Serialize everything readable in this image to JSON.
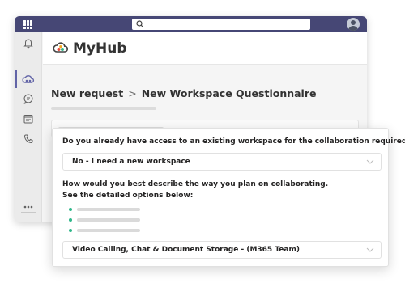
{
  "app": {
    "name": "MyHub"
  },
  "breadcrumb": {
    "parent": "New request",
    "separator": ">",
    "current": "New Workspace Questionnaire"
  },
  "rail": {
    "items": [
      {
        "icon": "bell-icon",
        "active": false
      },
      {
        "icon": "cloud-hub-icon",
        "active": true
      },
      {
        "icon": "chat-icon",
        "active": false
      },
      {
        "icon": "calendar-icon",
        "active": false
      },
      {
        "icon": "phone-icon",
        "active": false
      },
      {
        "icon": "more-icon",
        "active": false
      },
      {
        "icon": "apps-icon",
        "active": false
      }
    ]
  },
  "form": {
    "question1": {
      "label": "Do you already have access to an existing workspace for the collaboration required?",
      "value": "No - I need a new workspace"
    },
    "question2": {
      "label_line1": "How would you best describe the way you plan on collaborating.",
      "label_line2": "See the detailed options below:",
      "bullet_count": 3,
      "value": "Video Calling, Chat & Document Storage - (M365 Team)"
    }
  },
  "colors": {
    "topbar": "#464775",
    "accent": "#6264a7",
    "bullet": "#2fb78a"
  }
}
